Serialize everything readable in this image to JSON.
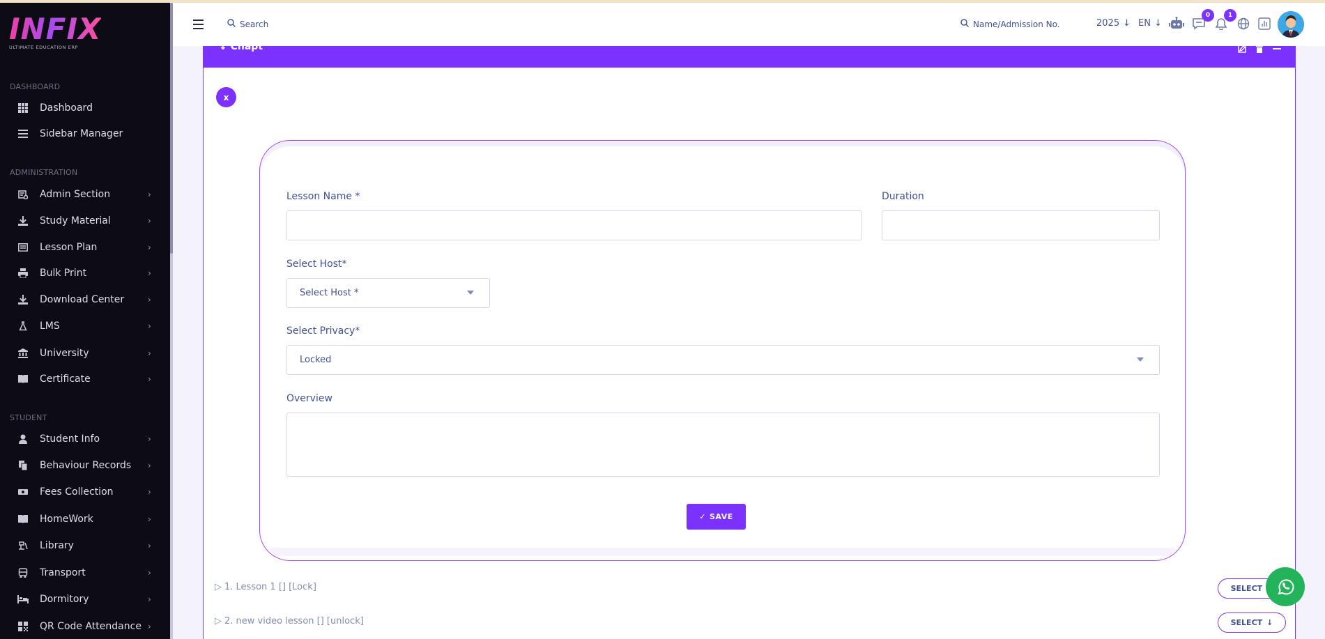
{
  "brand": {
    "name": "INFIX",
    "tagline": "ULTIMATE EDUCATION ERP"
  },
  "sidebar": {
    "sections": [
      {
        "heading": "DASHBOARD"
      },
      {
        "heading": "ADMINISTRATION"
      },
      {
        "heading": "STUDENT"
      }
    ],
    "items": [
      {
        "label": "Dashboard",
        "icon": "grid-icon"
      },
      {
        "label": "Sidebar Manager",
        "icon": "menu-lines-icon"
      },
      {
        "label": "Admin Section",
        "icon": "admin-icon"
      },
      {
        "label": "Study Material",
        "icon": "download-icon"
      },
      {
        "label": "Lesson Plan",
        "icon": "list-icon"
      },
      {
        "label": "Bulk Print",
        "icon": "printer-icon"
      },
      {
        "label": "Download Center",
        "icon": "download-icon"
      },
      {
        "label": "LMS",
        "icon": "flask-icon"
      },
      {
        "label": "University",
        "icon": "bank-icon"
      },
      {
        "label": "Certificate",
        "icon": "book-icon"
      },
      {
        "label": "Student Info",
        "icon": "user-icon"
      },
      {
        "label": "Behaviour Records",
        "icon": "copy-icon"
      },
      {
        "label": "Fees Collection",
        "icon": "money-icon"
      },
      {
        "label": "HomeWork",
        "icon": "book-open-icon"
      },
      {
        "label": "Library",
        "icon": "library-icon"
      },
      {
        "label": "Transport",
        "icon": "bus-icon"
      },
      {
        "label": "Dormitory",
        "icon": "bed-icon"
      },
      {
        "label": "QR Code Attendance",
        "icon": "qr-icon"
      }
    ]
  },
  "topbar": {
    "search_label": "Search",
    "admission_placeholder": "Name/Admission No.",
    "year": "2025",
    "language": "EN",
    "chat_badge": "0",
    "notification_badge": "1"
  },
  "card": {
    "title": "Chapt",
    "close_label": "x"
  },
  "form": {
    "lesson_name_label": "Lesson Name *",
    "lesson_name_value": "",
    "duration_label": "Duration",
    "duration_value": "",
    "host_label": "Select Host*",
    "host_selected": "Select Host *",
    "privacy_label": "Select Privacy*",
    "privacy_selected": "Locked",
    "overview_label": "Overview",
    "overview_value": "",
    "save_label": "SAVE"
  },
  "lessons": [
    {
      "text": "1. Lesson 1 [] [Lock]",
      "button": "SELECT"
    },
    {
      "text": "2. new video lesson [] [unlock]",
      "button": "SELECT"
    }
  ],
  "colors": {
    "accent": "#7c32ff",
    "sidebar_bg": "#0d0c15",
    "text": "#415094",
    "whatsapp": "#23b35a"
  }
}
